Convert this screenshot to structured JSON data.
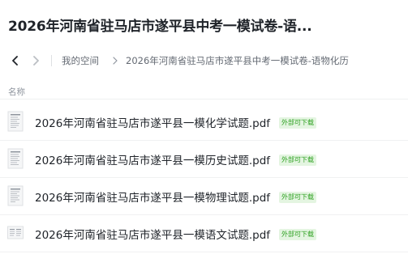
{
  "header": {
    "title": "2026年河南省驻马店市遂平县中考一模试卷-语..."
  },
  "breadcrumb": {
    "home": "我的空间",
    "current": "2026年河南省驻马店市遂平县中考一模试卷-语物化历"
  },
  "list": {
    "column_name": "名称",
    "files": [
      {
        "name": "2026年河南省驻马店市遂平县一模化学试题.pdf",
        "badge": "外部可下载"
      },
      {
        "name": "2026年河南省驻马店市遂平县一模历史试题.pdf",
        "badge": "外部可下载"
      },
      {
        "name": "2026年河南省驻马店市遂平县一模物理试题.pdf",
        "badge": "外部可下载"
      },
      {
        "name": "2026年河南省驻马店市遂平县一模语文试题.pdf",
        "badge": "外部可下载"
      }
    ]
  },
  "colors": {
    "text": "#1f2329",
    "secondary_text": "#646a73",
    "badge_text": "#2ea121",
    "badge_bg": "#e4f5e1"
  },
  "icons": {
    "back": "chevron-left-icon",
    "forward": "chevron-right-icon",
    "separator": "chevron-right-icon",
    "file": "pdf-thumbnail-icon"
  }
}
